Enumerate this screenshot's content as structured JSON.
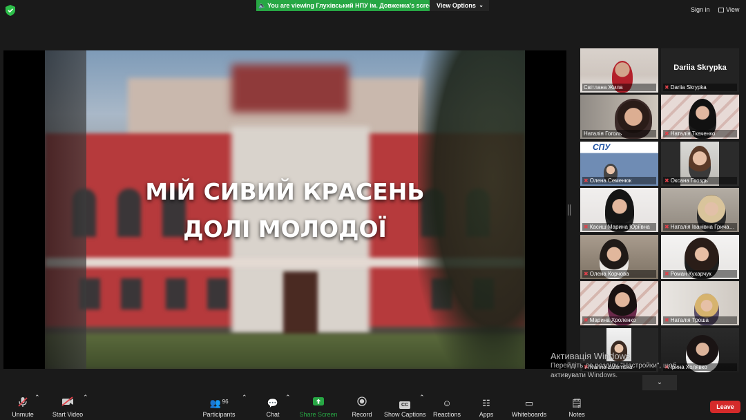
{
  "topbar": {
    "viewing_banner": "You are viewing Глухівський НПУ ім. Довженка's screen",
    "view_options": "View Options",
    "sign_in": "Sign in",
    "view": "View",
    "shield_color": "#2dbf4a"
  },
  "slide": {
    "title_line1": "МІЙ СИВИЙ КРАСЕНЬ",
    "title_line2": "ДОЛІ МОЛОДОЇ"
  },
  "participants": [
    {
      "name": "Світлана Жила",
      "muted": false
    },
    {
      "name": "Dariia Skrypka",
      "muted": true,
      "video_off": true
    },
    {
      "name": "Наталія Гоголь",
      "muted": false,
      "active_speaker": true
    },
    {
      "name": "Наталія Ткаченко",
      "muted": true
    },
    {
      "name": "Олена Семенюк",
      "muted": true,
      "logo_text": "СПУ"
    },
    {
      "name": "Оксана Гвоздь",
      "muted": true
    },
    {
      "name": "Касиш Марина Юріївна",
      "muted": true
    },
    {
      "name": "Наталія Іванівна Гричаник",
      "muted": true
    },
    {
      "name": "Олена Корчова",
      "muted": true
    },
    {
      "name": "Роман Кухарчук",
      "muted": true
    },
    {
      "name": "Марина Хроленко",
      "muted": true
    },
    {
      "name": "Наталія Троша",
      "muted": true
    },
    {
      "name": "Ivanna Zaremska",
      "muted": true
    },
    {
      "name": "Ірина Холявко",
      "muted": true
    }
  ],
  "windows_activation": {
    "line1": "Активація Windows",
    "line2": "Перейдіть до розділу \"Настройки\", щоб активувати Windows."
  },
  "toolbar": {
    "unmute": "Unmute",
    "start_video": "Start Video",
    "participants": "Participants",
    "participants_count": "96",
    "chat": "Chat",
    "share_screen": "Share Screen",
    "record": "Record",
    "show_captions": "Show Captions",
    "reactions": "Reactions",
    "apps": "Apps",
    "whiteboards": "Whiteboards",
    "notes": "Notes",
    "leave": "Leave",
    "share_color": "#27a744",
    "leave_color": "#d42a2a"
  }
}
